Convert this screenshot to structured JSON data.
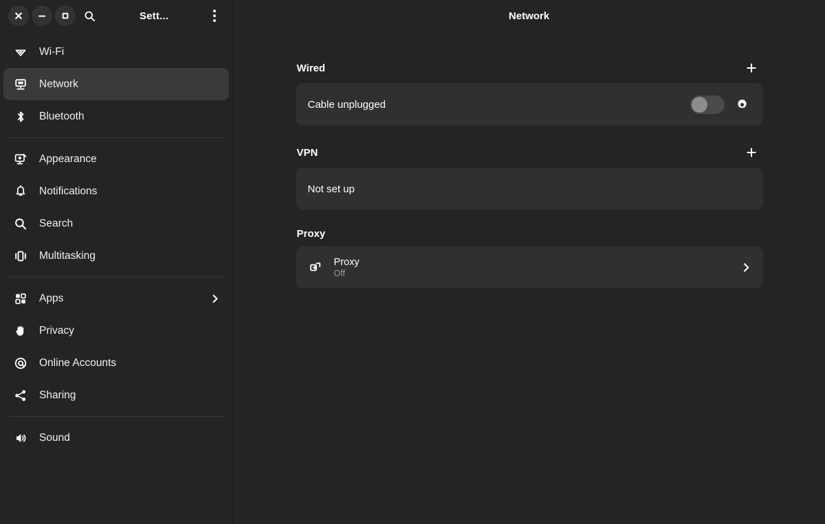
{
  "window": {
    "titlebar": {
      "close_label": "Close",
      "minimize_label": "Minimize",
      "maximize_label": "Maximize",
      "search_label": "Search",
      "title": "Sett...",
      "menu_label": "Main Menu"
    },
    "content_title": "Network"
  },
  "sidebar": {
    "groups": [
      {
        "items": [
          {
            "label": "Wi-Fi",
            "icon": "wifi-icon",
            "selected": false,
            "chevron": false
          },
          {
            "label": "Network",
            "icon": "network-icon",
            "selected": true,
            "chevron": false
          },
          {
            "label": "Bluetooth",
            "icon": "bluetooth-icon",
            "selected": false,
            "chevron": false
          }
        ]
      },
      {
        "items": [
          {
            "label": "Appearance",
            "icon": "appearance-icon",
            "selected": false,
            "chevron": false
          },
          {
            "label": "Notifications",
            "icon": "bell-icon",
            "selected": false,
            "chevron": false
          },
          {
            "label": "Search",
            "icon": "search-icon",
            "selected": false,
            "chevron": false
          },
          {
            "label": "Multitasking",
            "icon": "multitasking-icon",
            "selected": false,
            "chevron": false
          }
        ]
      },
      {
        "items": [
          {
            "label": "Apps",
            "icon": "apps-icon",
            "selected": false,
            "chevron": true
          },
          {
            "label": "Privacy",
            "icon": "hand-icon",
            "selected": false,
            "chevron": false
          },
          {
            "label": "Online Accounts",
            "icon": "at-sign-icon",
            "selected": false,
            "chevron": false
          },
          {
            "label": "Sharing",
            "icon": "share-icon",
            "selected": false,
            "chevron": false
          }
        ]
      },
      {
        "items": [
          {
            "label": "Sound",
            "icon": "speaker-icon",
            "selected": false,
            "chevron": false
          }
        ]
      }
    ]
  },
  "main": {
    "sections": [
      {
        "title": "Wired",
        "add_label": "+",
        "row": {
          "text": "Cable unplugged",
          "toggle_on": false,
          "settings_icon": "gear-icon"
        }
      },
      {
        "title": "VPN",
        "add_label": "+",
        "row": {
          "text": "Not set up"
        }
      },
      {
        "title": "Proxy",
        "row": {
          "title": "Proxy",
          "subtitle": "Off",
          "icon": "proxy-icon",
          "chevron": "chevron-right-icon"
        }
      }
    ]
  },
  "colors": {
    "window_bg": "#242424",
    "card_bg": "#303030",
    "selected_row": "#3a3a3a",
    "text_primary": "#ffffff",
    "text_secondary": "#9a9a9a",
    "toggle_track": "#4a4a4a",
    "toggle_knob": "#8d8d8d"
  }
}
